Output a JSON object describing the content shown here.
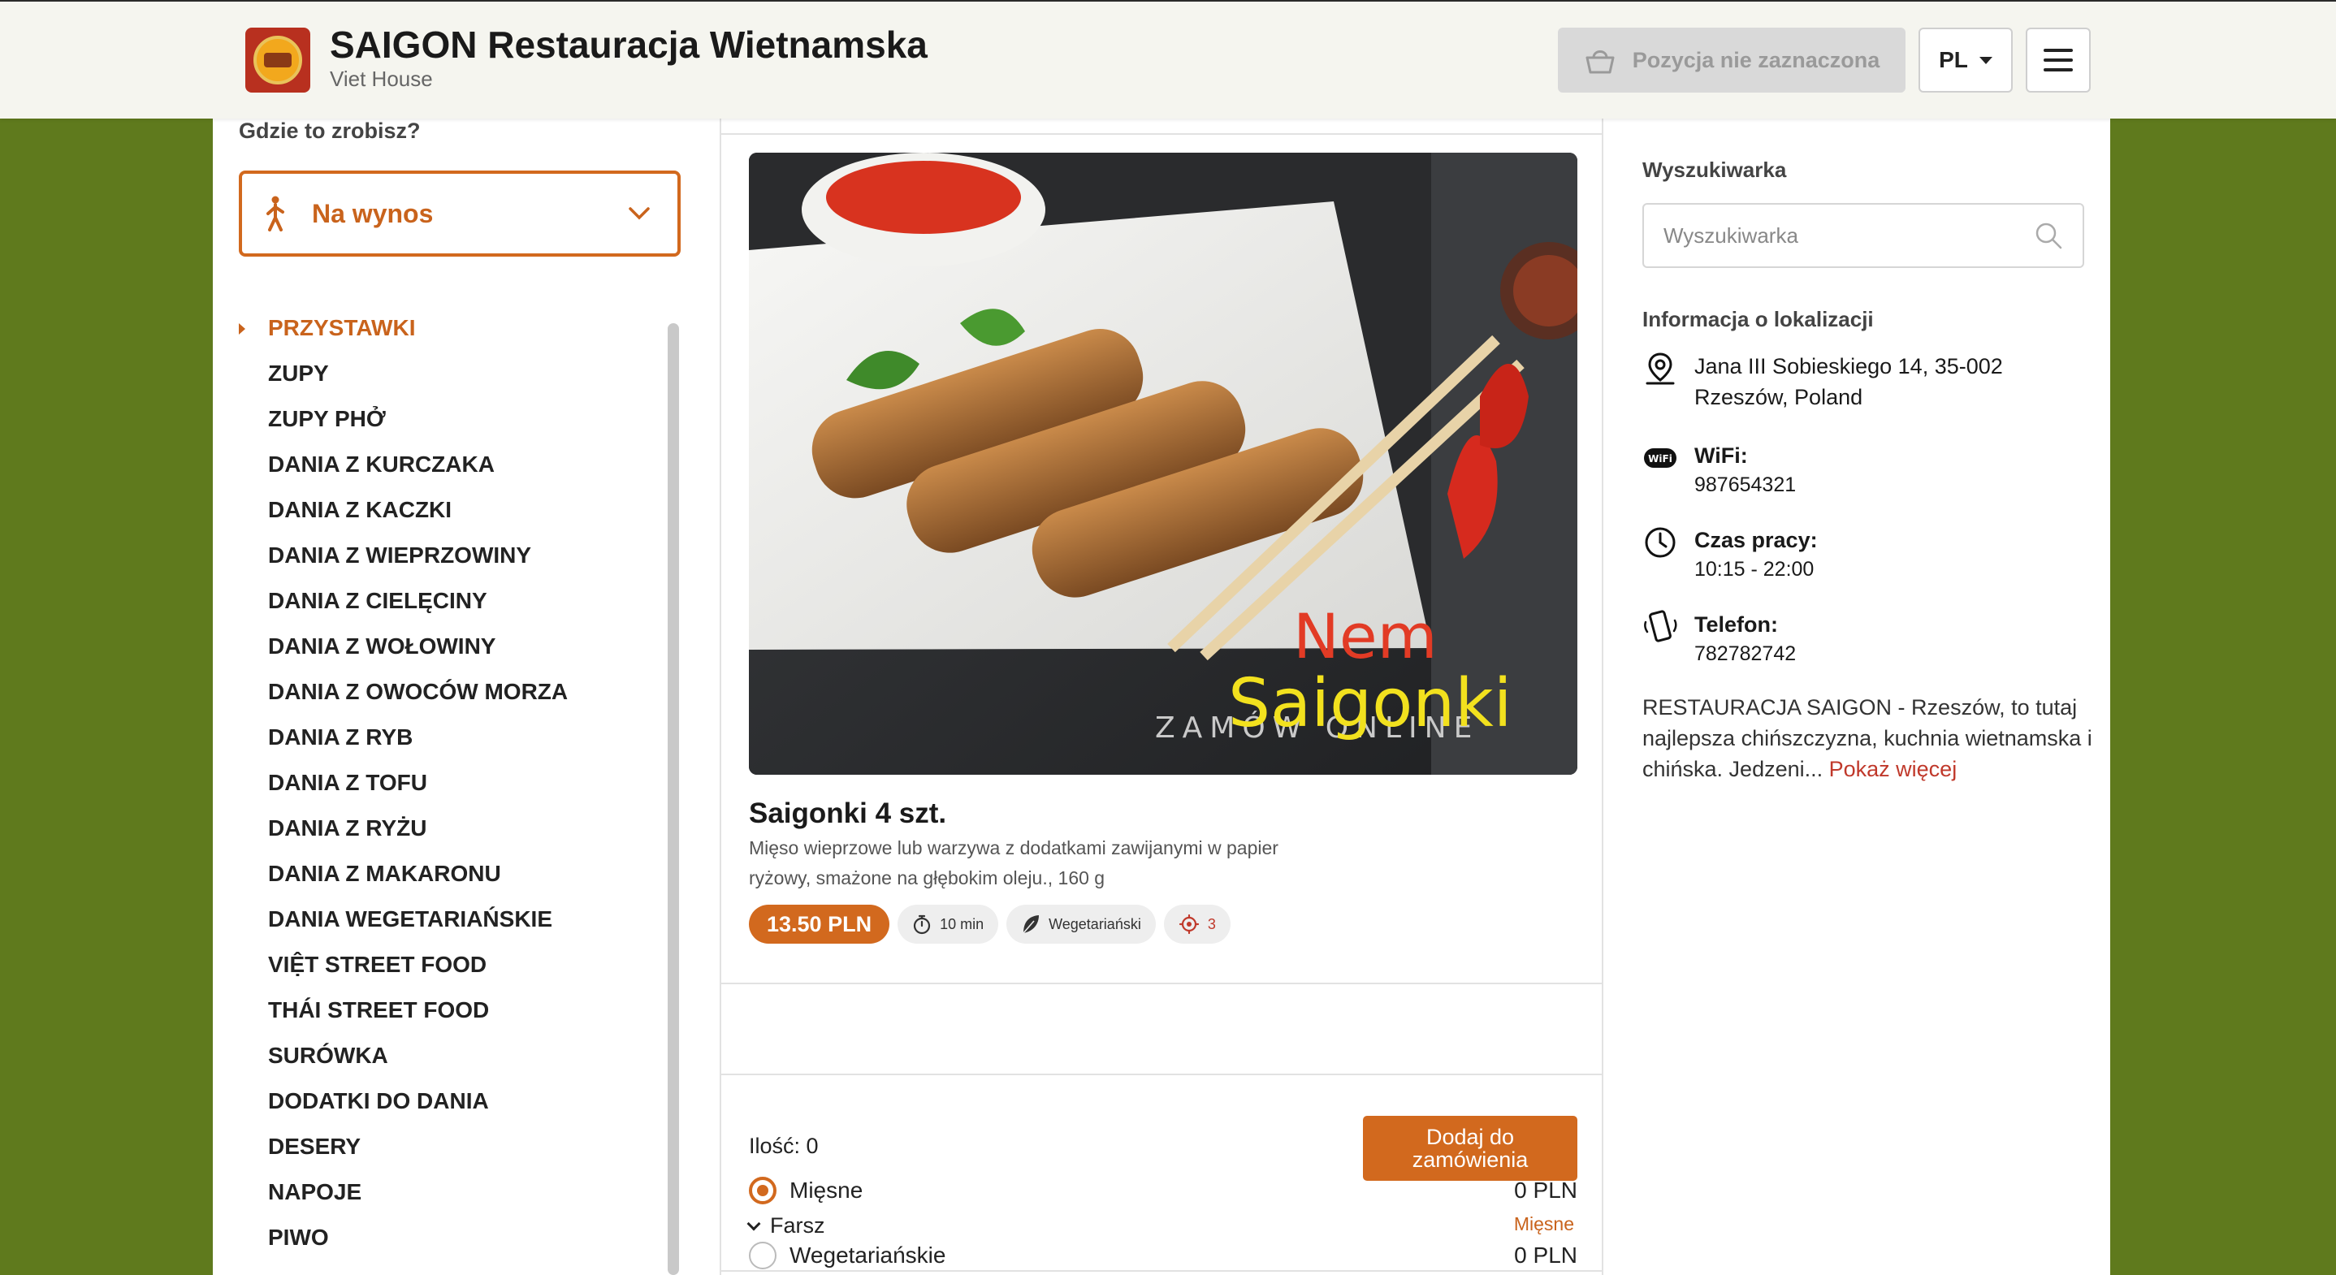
{
  "header": {
    "brand_title": "SAIGON Restauracja Wietnamska",
    "brand_subtitle": "Viet House",
    "cart_label": "Pozycja nie zaznaczona",
    "language": "PL"
  },
  "order_type": {
    "question": "Gdzie to zrobisz?",
    "selected": "Na wynos"
  },
  "categories": [
    {
      "label": "PRZYSTAWKI",
      "active": true
    },
    {
      "label": "ZUPY"
    },
    {
      "label": "ZUPY PHỞ"
    },
    {
      "label": "DANIA Z KURCZAKA"
    },
    {
      "label": "DANIA Z KACZKI"
    },
    {
      "label": "DANIA Z WIEPRZOWINY"
    },
    {
      "label": "DANIA Z CIELĘCINY"
    },
    {
      "label": "DANIA Z WOŁOWINY"
    },
    {
      "label": "DANIA Z OWOCÓW MORZA"
    },
    {
      "label": "DANIA Z RYB"
    },
    {
      "label": "DANIA Z TOFU"
    },
    {
      "label": "DANIA Z RYŻU"
    },
    {
      "label": "DANIA Z MAKARONU"
    },
    {
      "label": "DANIA WEGETARIAŃSKIE"
    },
    {
      "label": "VIỆT STREET FOOD"
    },
    {
      "label": "THÁI STREET FOOD"
    },
    {
      "label": "SURÓWKA"
    },
    {
      "label": "DODATKI DO DANIA"
    },
    {
      "label": "DESERY"
    },
    {
      "label": "NAPOJE"
    },
    {
      "label": "PIWO"
    }
  ],
  "item": {
    "image_text": {
      "line1": "Nem",
      "line2": "Saigonki",
      "tagline": "ZAMÓW ONLINE"
    },
    "title": "Saigonki 4 szt.",
    "description": "Mięso wieprzowe lub warzywa z dodatkami zawijanymi w papier ryżowy, smażone na głębokim oleju., 160 g",
    "price": "13.50 PLN",
    "time": "10 min",
    "diet": "Wegetariański",
    "spice_level": "3",
    "quantity_label": "Ilość: 0",
    "add_button": "Dodaj do zamówienia",
    "option_group": {
      "title": "Farsz",
      "selected": "Mięsne",
      "options": [
        {
          "label": "Mięsne",
          "price": "0 PLN",
          "selected": true
        },
        {
          "label": "Wegetariańskie",
          "price": "0 PLN",
          "selected": false
        }
      ]
    }
  },
  "sidebar": {
    "search_label": "Wyszukiwarka",
    "search_placeholder": "Wyszukiwarka",
    "location_label": "Informacja o lokalizacji",
    "address": "Jana III Sobieskiego 14, 35-002 Rzeszów, Poland",
    "wifi_label": "WiFi:",
    "wifi_value": "987654321",
    "hours_label": "Czas pracy:",
    "hours_value": "10:15 - 22:00",
    "phone_label": "Telefon:",
    "phone_value": "782782742",
    "about_text": "RESTAURACJA SAIGON - Rzeszów, to tutaj najlepsza chińszczyzna, kuchnia wietnamska i chińska. Jedzeni... ",
    "about_more": "Pokaż więcej"
  },
  "colors": {
    "accent": "#d2691e",
    "background": "#5f7a1d",
    "header": "#f5f5ef"
  }
}
